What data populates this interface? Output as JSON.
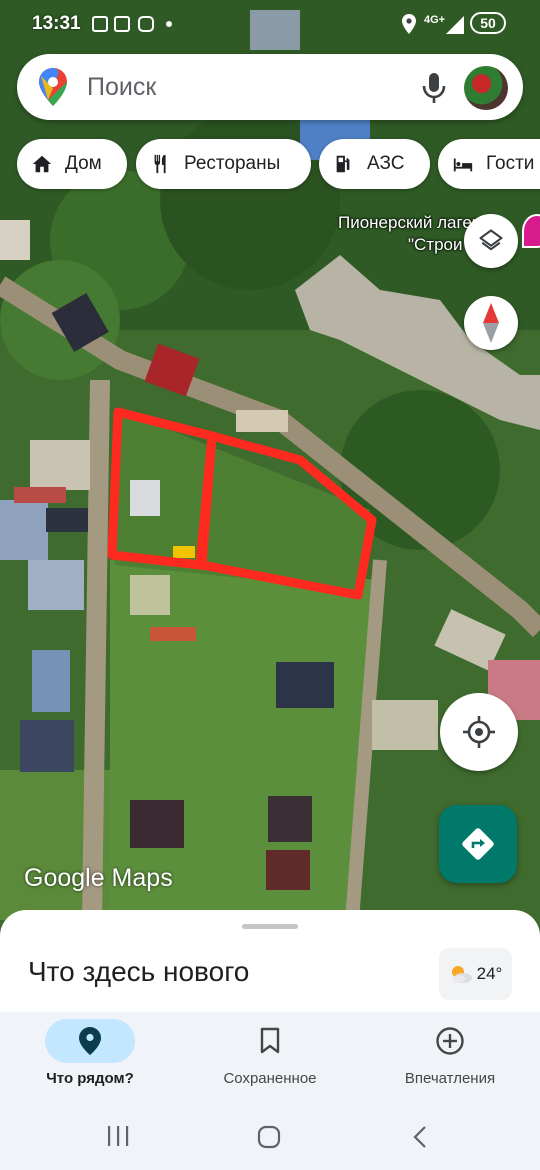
{
  "status_bar": {
    "time": "13:31",
    "network": "4G+",
    "battery": "50"
  },
  "search": {
    "placeholder": "Поиск"
  },
  "chips": [
    {
      "label": "Дом",
      "icon": "home-icon"
    },
    {
      "label": "Рестораны",
      "icon": "restaurant-icon"
    },
    {
      "label": "АЗС",
      "icon": "gas-station-icon"
    },
    {
      "label": "Гости",
      "icon": "hotel-icon"
    }
  ],
  "map": {
    "place_label_line1": "Пионерский лагерь",
    "place_label_line2": "\"Строи",
    "watermark": "Google Maps",
    "marked_area_color": "#ff2a1f"
  },
  "sheet": {
    "title": "Что здесь нового",
    "weather": "24°"
  },
  "nav": [
    {
      "label": "Что рядом?",
      "icon": "location-pin-icon",
      "active": true
    },
    {
      "label": "Сохраненное",
      "icon": "bookmark-icon",
      "active": false
    },
    {
      "label": "Впечатления",
      "icon": "add-circle-icon",
      "active": false
    }
  ],
  "colors": {
    "accent": "#00796b",
    "active_nav_bg": "#c2e7ff",
    "sheet_bg": "#ffffff"
  }
}
